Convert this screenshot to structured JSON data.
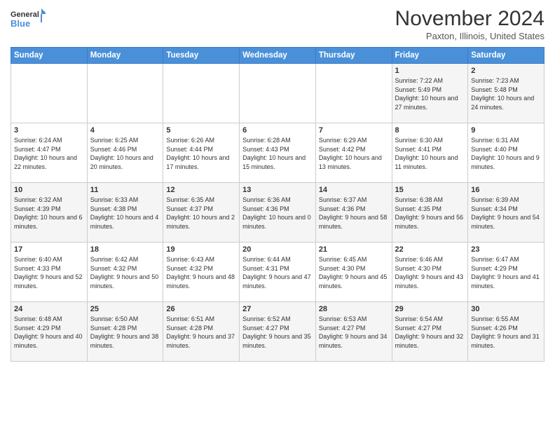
{
  "header": {
    "logo_line1": "General",
    "logo_line2": "Blue",
    "month_title": "November 2024",
    "subtitle": "Paxton, Illinois, United States"
  },
  "weekdays": [
    "Sunday",
    "Monday",
    "Tuesday",
    "Wednesday",
    "Thursday",
    "Friday",
    "Saturday"
  ],
  "weeks": [
    [
      {
        "day": "",
        "info": ""
      },
      {
        "day": "",
        "info": ""
      },
      {
        "day": "",
        "info": ""
      },
      {
        "day": "",
        "info": ""
      },
      {
        "day": "",
        "info": ""
      },
      {
        "day": "1",
        "info": "Sunrise: 7:22 AM\nSunset: 5:49 PM\nDaylight: 10 hours and 27 minutes."
      },
      {
        "day": "2",
        "info": "Sunrise: 7:23 AM\nSunset: 5:48 PM\nDaylight: 10 hours and 24 minutes."
      }
    ],
    [
      {
        "day": "3",
        "info": "Sunrise: 6:24 AM\nSunset: 4:47 PM\nDaylight: 10 hours and 22 minutes."
      },
      {
        "day": "4",
        "info": "Sunrise: 6:25 AM\nSunset: 4:46 PM\nDaylight: 10 hours and 20 minutes."
      },
      {
        "day": "5",
        "info": "Sunrise: 6:26 AM\nSunset: 4:44 PM\nDaylight: 10 hours and 17 minutes."
      },
      {
        "day": "6",
        "info": "Sunrise: 6:28 AM\nSunset: 4:43 PM\nDaylight: 10 hours and 15 minutes."
      },
      {
        "day": "7",
        "info": "Sunrise: 6:29 AM\nSunset: 4:42 PM\nDaylight: 10 hours and 13 minutes."
      },
      {
        "day": "8",
        "info": "Sunrise: 6:30 AM\nSunset: 4:41 PM\nDaylight: 10 hours and 11 minutes."
      },
      {
        "day": "9",
        "info": "Sunrise: 6:31 AM\nSunset: 4:40 PM\nDaylight: 10 hours and 9 minutes."
      }
    ],
    [
      {
        "day": "10",
        "info": "Sunrise: 6:32 AM\nSunset: 4:39 PM\nDaylight: 10 hours and 6 minutes."
      },
      {
        "day": "11",
        "info": "Sunrise: 6:33 AM\nSunset: 4:38 PM\nDaylight: 10 hours and 4 minutes."
      },
      {
        "day": "12",
        "info": "Sunrise: 6:35 AM\nSunset: 4:37 PM\nDaylight: 10 hours and 2 minutes."
      },
      {
        "day": "13",
        "info": "Sunrise: 6:36 AM\nSunset: 4:36 PM\nDaylight: 10 hours and 0 minutes."
      },
      {
        "day": "14",
        "info": "Sunrise: 6:37 AM\nSunset: 4:36 PM\nDaylight: 9 hours and 58 minutes."
      },
      {
        "day": "15",
        "info": "Sunrise: 6:38 AM\nSunset: 4:35 PM\nDaylight: 9 hours and 56 minutes."
      },
      {
        "day": "16",
        "info": "Sunrise: 6:39 AM\nSunset: 4:34 PM\nDaylight: 9 hours and 54 minutes."
      }
    ],
    [
      {
        "day": "17",
        "info": "Sunrise: 6:40 AM\nSunset: 4:33 PM\nDaylight: 9 hours and 52 minutes."
      },
      {
        "day": "18",
        "info": "Sunrise: 6:42 AM\nSunset: 4:32 PM\nDaylight: 9 hours and 50 minutes."
      },
      {
        "day": "19",
        "info": "Sunrise: 6:43 AM\nSunset: 4:32 PM\nDaylight: 9 hours and 48 minutes."
      },
      {
        "day": "20",
        "info": "Sunrise: 6:44 AM\nSunset: 4:31 PM\nDaylight: 9 hours and 47 minutes."
      },
      {
        "day": "21",
        "info": "Sunrise: 6:45 AM\nSunset: 4:30 PM\nDaylight: 9 hours and 45 minutes."
      },
      {
        "day": "22",
        "info": "Sunrise: 6:46 AM\nSunset: 4:30 PM\nDaylight: 9 hours and 43 minutes."
      },
      {
        "day": "23",
        "info": "Sunrise: 6:47 AM\nSunset: 4:29 PM\nDaylight: 9 hours and 41 minutes."
      }
    ],
    [
      {
        "day": "24",
        "info": "Sunrise: 6:48 AM\nSunset: 4:29 PM\nDaylight: 9 hours and 40 minutes."
      },
      {
        "day": "25",
        "info": "Sunrise: 6:50 AM\nSunset: 4:28 PM\nDaylight: 9 hours and 38 minutes."
      },
      {
        "day": "26",
        "info": "Sunrise: 6:51 AM\nSunset: 4:28 PM\nDaylight: 9 hours and 37 minutes."
      },
      {
        "day": "27",
        "info": "Sunrise: 6:52 AM\nSunset: 4:27 PM\nDaylight: 9 hours and 35 minutes."
      },
      {
        "day": "28",
        "info": "Sunrise: 6:53 AM\nSunset: 4:27 PM\nDaylight: 9 hours and 34 minutes."
      },
      {
        "day": "29",
        "info": "Sunrise: 6:54 AM\nSunset: 4:27 PM\nDaylight: 9 hours and 32 minutes."
      },
      {
        "day": "30",
        "info": "Sunrise: 6:55 AM\nSunset: 4:26 PM\nDaylight: 9 hours and 31 minutes."
      }
    ]
  ]
}
